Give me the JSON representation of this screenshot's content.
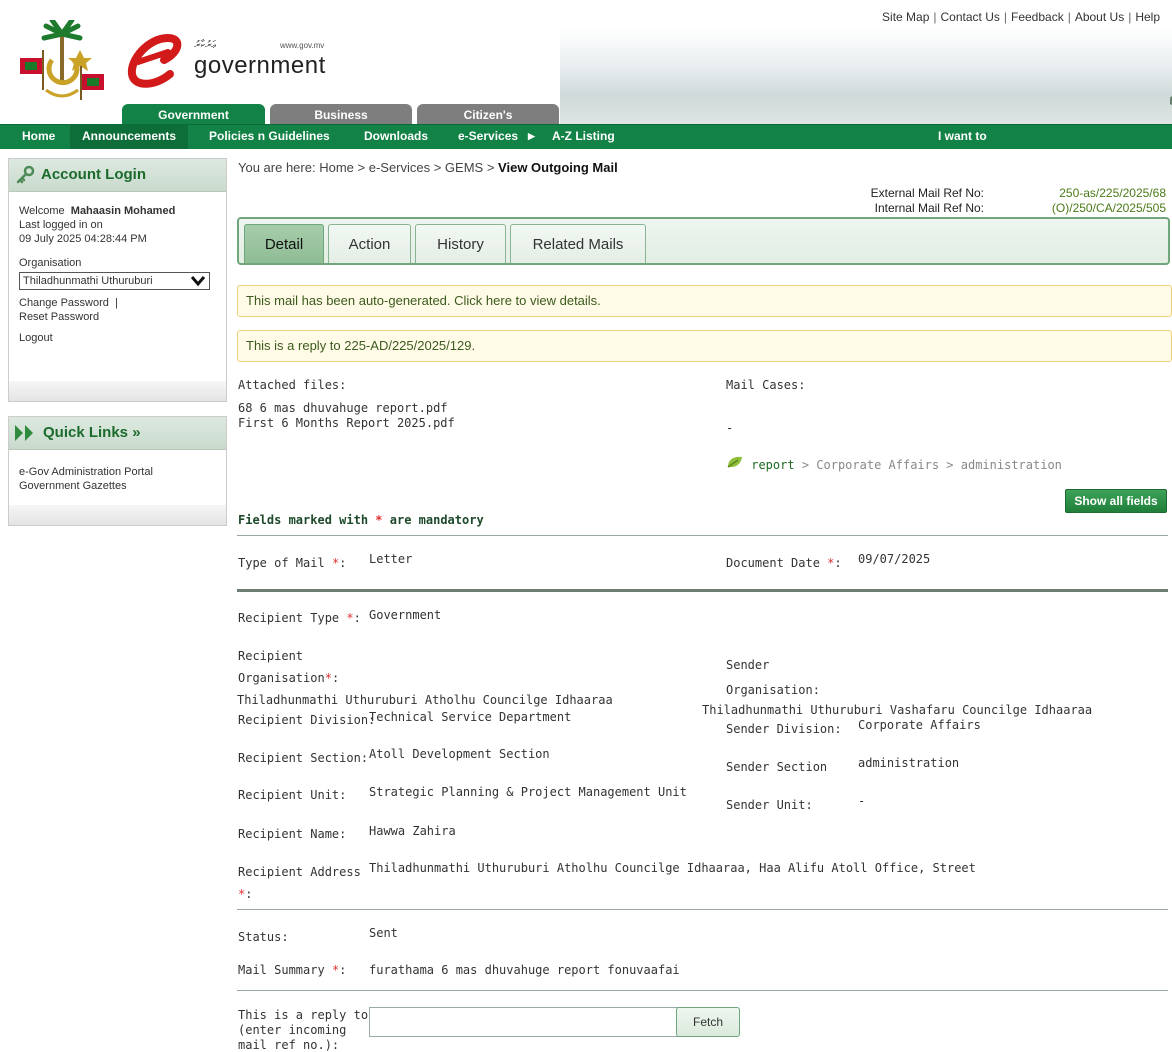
{
  "top_links": [
    "Site Map",
    "Contact Us",
    "Feedback",
    "About Us",
    "Help"
  ],
  "brand": {
    "dhivehi": "ޢަރުކާރު",
    "url": "www.gov.mv",
    "name": "government"
  },
  "main_tabs": [
    "Government",
    "Business",
    "Citizen's"
  ],
  "nav": {
    "items": [
      "Home",
      "Announcements",
      "Policies n Guidelines",
      "Downloads",
      "e-Services",
      "A-Z Listing"
    ],
    "right": "I want to"
  },
  "account": {
    "title": "Account Login",
    "welcome_label": "Welcome",
    "user": "Mahaasin Mohamed",
    "last_logged_label": "Last logged in on",
    "last_logged": "09 July 2025 04:28:44 PM",
    "org_label": "Organisation",
    "org_value": "Thiladhunmathi Uthuruburi",
    "change_password": "Change Password",
    "reset_password": "Reset Password",
    "logout": "Logout"
  },
  "quick_links": {
    "title": "Quick Links »",
    "items": [
      "e-Gov Administration Portal",
      "Government Gazettes"
    ]
  },
  "breadcrumb": {
    "prefix": "You are here:",
    "path": "Home > e-Services > GEMS >",
    "current": "View Outgoing Mail"
  },
  "refs": {
    "external_label": "External Mail Ref No:",
    "external_value": "250-as/225/2025/68",
    "internal_label": "Internal Mail Ref No:",
    "internal_value": "(O)/250/CA/2025/505"
  },
  "detail_tabs": [
    "Detail",
    "Action",
    "History",
    "Related Mails"
  ],
  "notices": {
    "auto": "This mail has been auto-generated. Click here to view details.",
    "reply": "This is a reply to 225-AD/225/2025/129."
  },
  "attachments": {
    "label": "Attached files:",
    "files": [
      "68 6 mas dhuvahuge report.pdf",
      "First 6 Months Report 2025.pdf"
    ]
  },
  "mail_cases": {
    "label": "Mail Cases:",
    "value": "-",
    "case_link": "report",
    "case_path": " > Corporate Affairs > administration"
  },
  "show_all": "Show all fields",
  "mandatory": {
    "prefix": "Fields marked with",
    "star": "*",
    "suffix": "are mandatory"
  },
  "fields": {
    "type_of_mail_label": "Type of Mail",
    "type_of_mail": "Letter",
    "document_date_label": "Document Date",
    "document_date": "09/07/2025",
    "recipient_type_label": "Recipient Type",
    "recipient_type": "Government",
    "recipient_label_1": "Recipient",
    "recipient_label_2": "Organisation",
    "recipient_org": "Thiladhunmathi Uthuruburi Atholhu Councilge Idhaaraa",
    "sender_label": "Sender",
    "sender_org_label": "Organisation:",
    "sender_org": "Thiladhunmathi Uthuruburi Vashafaru Councilge Idhaaraa",
    "recipient_division_label": "Recipient Division:",
    "recipient_division": "Technical Service Department",
    "sender_division_label": "Sender Division:",
    "sender_division": "Corporate Affairs",
    "recipient_section_label": "Recipient Section:",
    "recipient_section": "Atoll Development Section",
    "sender_section_label": "Sender Section",
    "sender_section": "administration",
    "recipient_unit_label": "Recipient Unit:",
    "recipient_unit": "Strategic Planning & Project Management Unit",
    "sender_unit_label": "Sender Unit:",
    "sender_unit": "-",
    "recipient_name_label": "Recipient Name:",
    "recipient_name": "Hawwa Zahira",
    "recipient_address_label": "Recipient Address",
    "recipient_address": "Thiladhunmathi Uthuruburi Atholhu Councilge Idhaaraa, Haa Alifu Atoll Office, Street",
    "status_label": "Status:",
    "status": "Sent",
    "mail_summary_label": "Mail Summary",
    "mail_summary": "furathama 6 mas dhuvahuge report fonuvaafai",
    "reply_label_1": "This is a reply to",
    "reply_label_2": "(enter incoming",
    "reply_label_3": "mail ref no.):",
    "reply_value": "",
    "fetch": "Fetch"
  },
  "colors": {
    "nav_green": "#128246",
    "accent_green": "#6fa67c",
    "link_green": "#4b7a17",
    "required_red": "#e03030",
    "notice_border": "#f0d27a"
  }
}
